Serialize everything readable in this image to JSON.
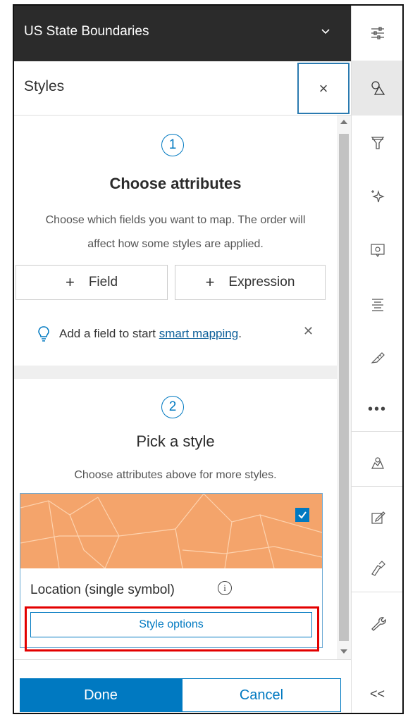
{
  "header": {
    "title": "US State Boundaries"
  },
  "panel": {
    "title": "Styles"
  },
  "step1": {
    "number": "1",
    "heading": "Choose attributes",
    "description_line1": "Choose which fields you want to map. The order will",
    "description_line2": "affect how some styles are applied.",
    "field_button": "Field",
    "expression_button": "Expression",
    "hint_text": "Add a field to start ",
    "hint_link": "smart mapping",
    "hint_end": "."
  },
  "step2": {
    "number": "2",
    "heading": "Pick a style",
    "description": "Choose attributes above for more styles.",
    "style_card": {
      "label": "Location (single symbol)",
      "selected": true,
      "options_button": "Style options"
    }
  },
  "footer": {
    "done": "Done",
    "cancel": "Cancel"
  },
  "colors": {
    "accent": "#0079c1",
    "highlight": "#e30000",
    "map_fill": "#f4a46b",
    "header_bg": "#2b2b2b"
  },
  "toolbar": {
    "icons": [
      "properties-icon",
      "styles-icon",
      "filter-icon",
      "effects-icon",
      "popups-icon",
      "labels-icon",
      "configure-fields-icon",
      "more-icon",
      "analysis-icon",
      "edit-icon",
      "sketch-icon",
      "tools-icon",
      "collapse-icon"
    ],
    "collapse_label": "<<"
  }
}
